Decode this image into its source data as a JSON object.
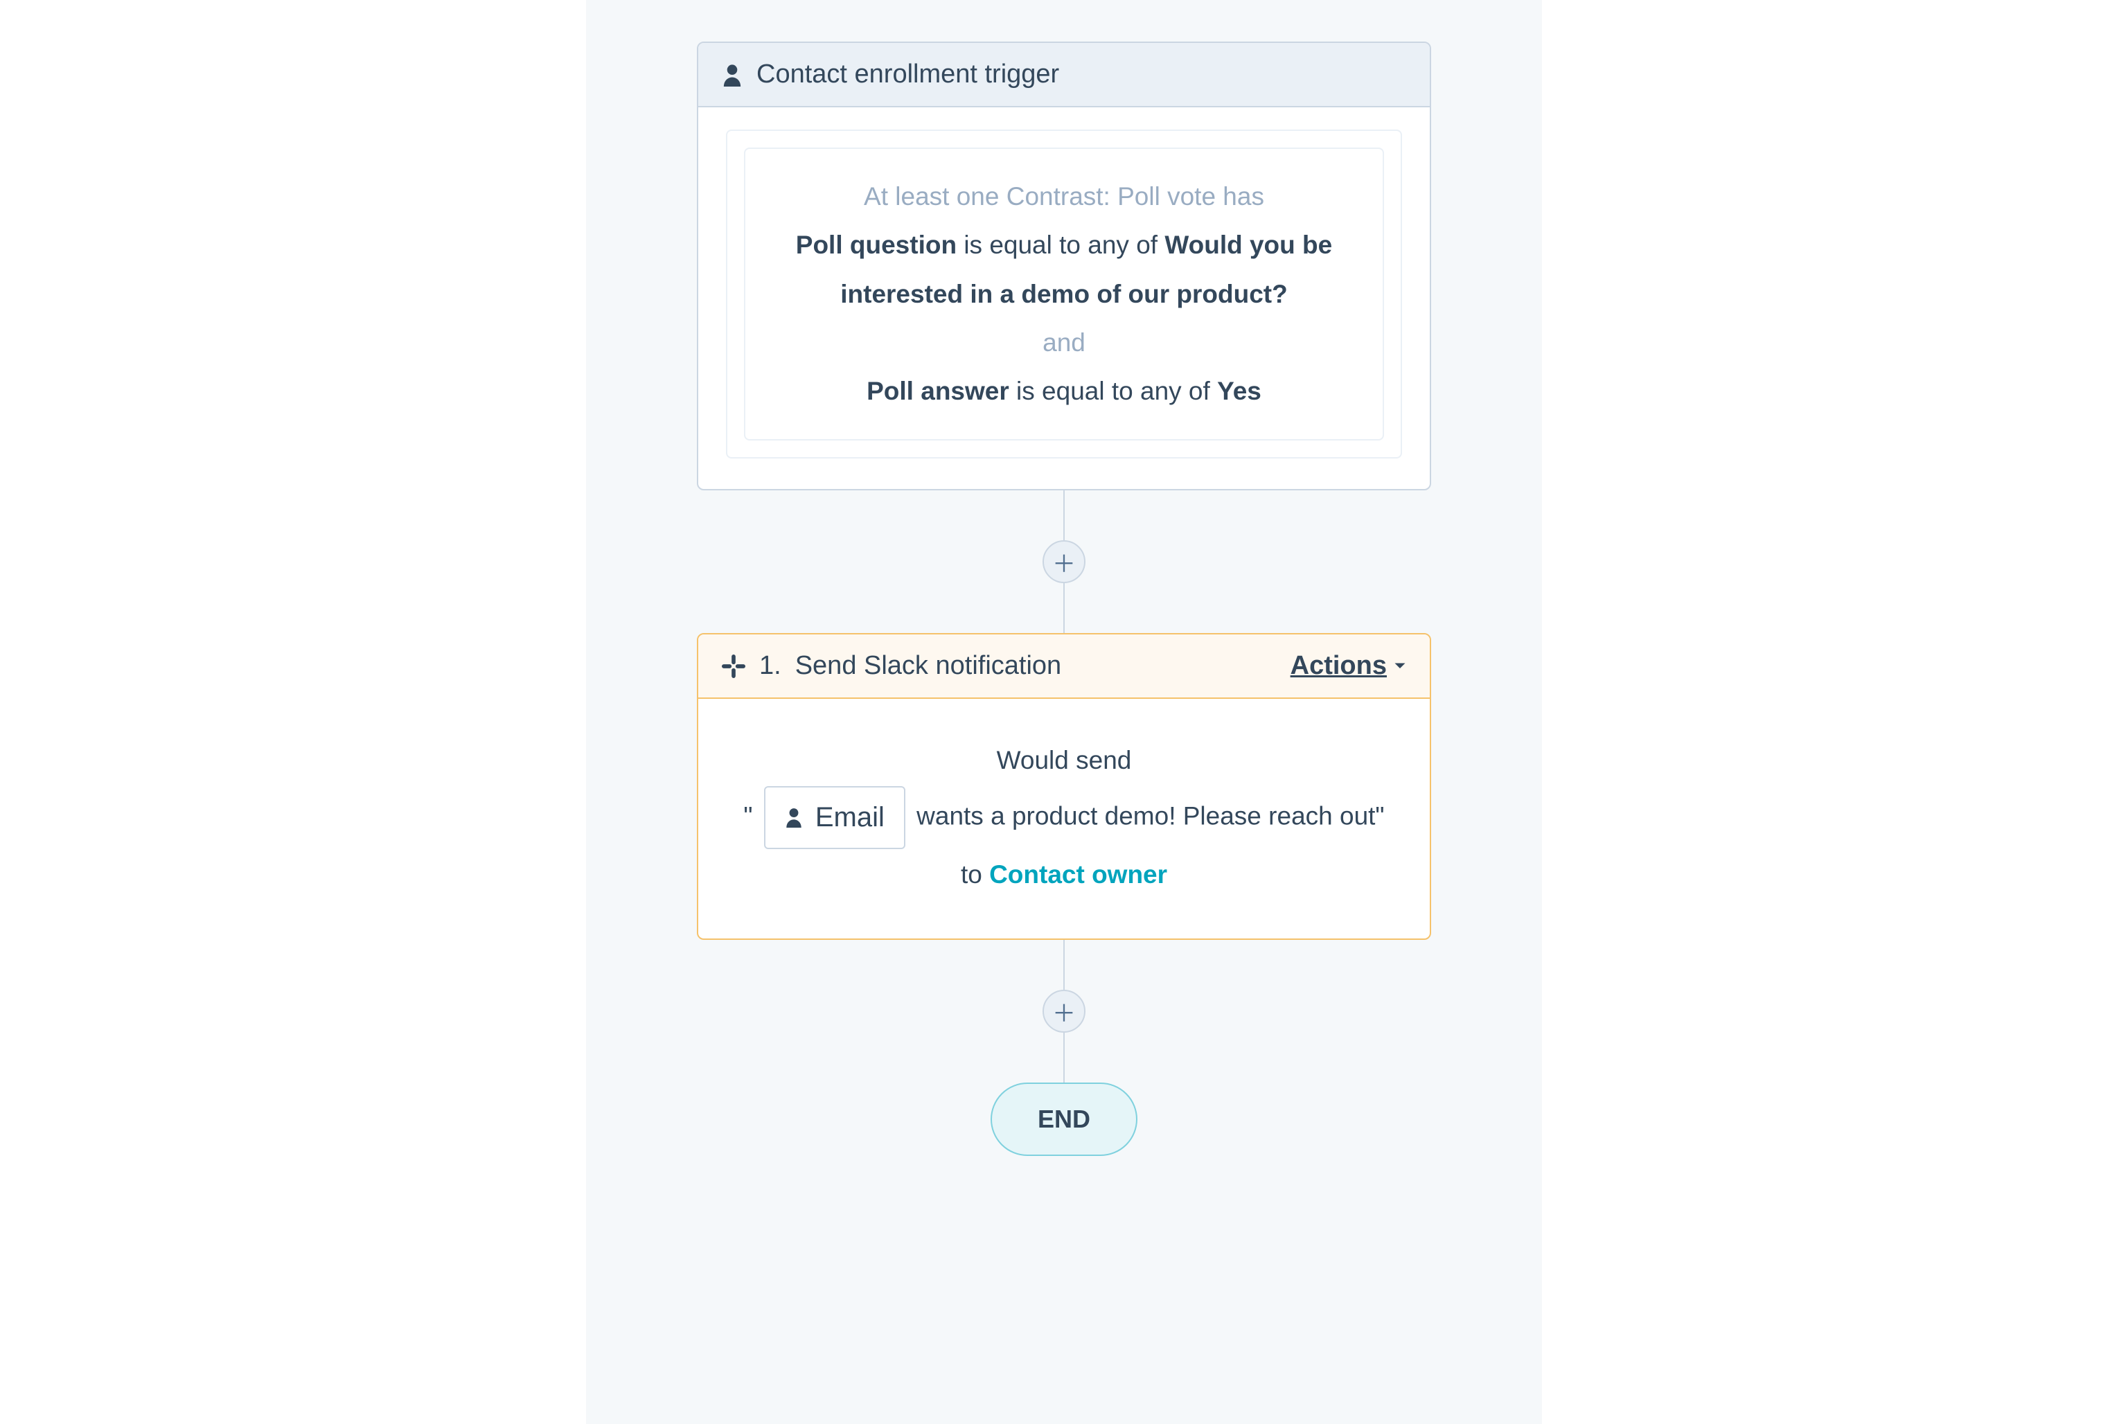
{
  "trigger": {
    "title": "Contact enrollment trigger",
    "lead_muted": "At least one Contrast: Poll vote has",
    "clause1_field": "Poll question",
    "clause1_op": " is equal to any of ",
    "clause1_value": "Would you be interested in a demo of our product?",
    "conj_muted": "and",
    "clause2_field": "Poll answer",
    "clause2_op": " is equal to any of ",
    "clause2_value": "Yes"
  },
  "action": {
    "index": "1.",
    "title": "Send Slack notification",
    "actions_label": "Actions",
    "would_send": "Would send",
    "quote_open": "\"",
    "token_label": "Email",
    "tail_text": " wants a product demo! Please reach out\"",
    "to_label": "to ",
    "recipient": "Contact owner"
  },
  "end_label": "END",
  "plus": "＋"
}
